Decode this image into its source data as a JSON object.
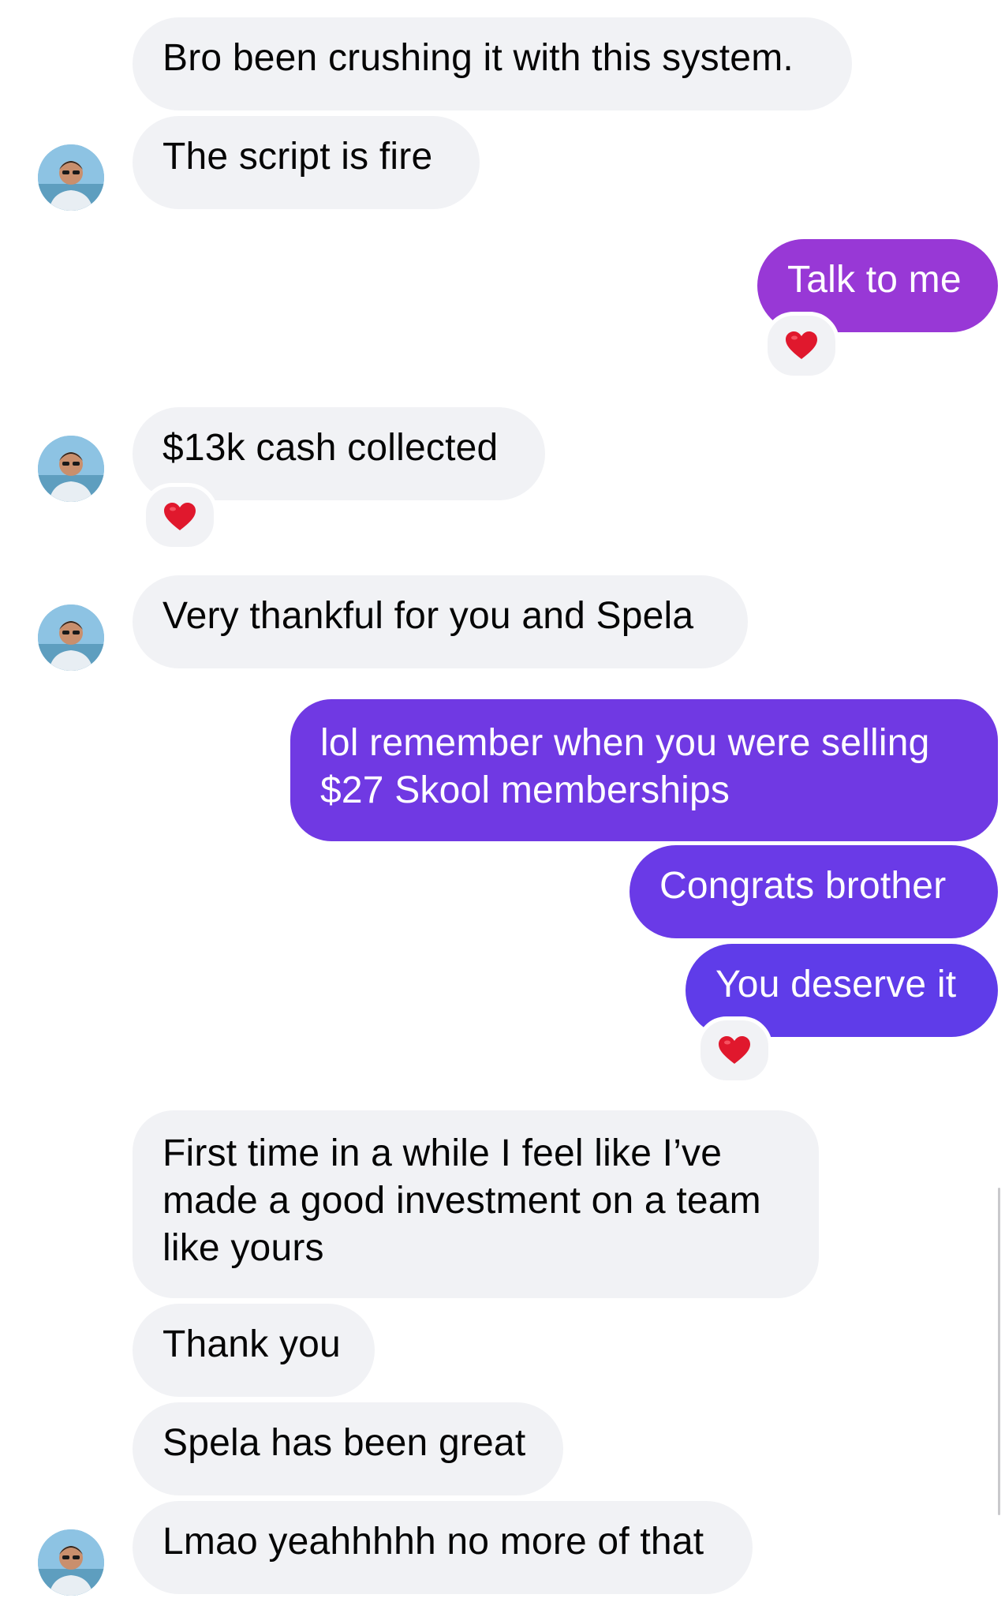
{
  "colors": {
    "incoming_bubble": "#f1f2f5",
    "outgoing_top": "#9838d6",
    "outgoing_mid": "#6c3ae6",
    "outgoing_bottom": "#5d3de9",
    "reaction_heart": "#e0182d"
  },
  "messages": [
    {
      "from": "them",
      "text": "Bro been crushing it with this system."
    },
    {
      "from": "them",
      "text": "The script is fire"
    },
    {
      "from": "me",
      "text": "Talk to me",
      "reaction": "heart-icon"
    },
    {
      "from": "them",
      "text": "$13k cash collected",
      "reaction": "heart-icon"
    },
    {
      "from": "them",
      "text": "Very thankful for you and Spela"
    },
    {
      "from": "me",
      "lines": [
        "lol remember when you were selling",
        "$27 Skool memberships"
      ]
    },
    {
      "from": "me",
      "text": "Congrats brother"
    },
    {
      "from": "me",
      "text": "You deserve it",
      "reaction": "heart-icon"
    },
    {
      "from": "them",
      "lines": [
        "First time in a while I feel like I’ve",
        "made a good investment on a team",
        "like yours"
      ]
    },
    {
      "from": "them",
      "text": "Thank you"
    },
    {
      "from": "them",
      "text": "Spela has been great"
    },
    {
      "from": "them",
      "text": "Lmao yeahhhhh no more of that"
    }
  ]
}
